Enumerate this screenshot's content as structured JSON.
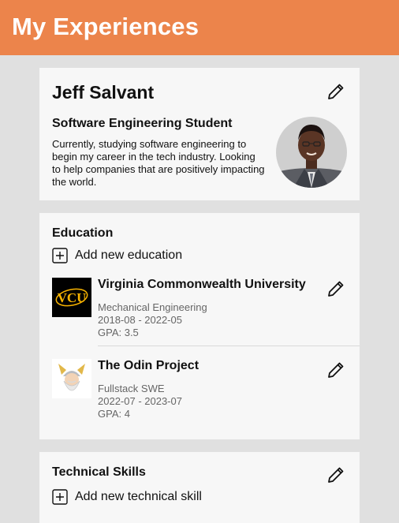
{
  "header": {
    "title": "My Experiences"
  },
  "profile": {
    "name": "Jeff Salvant",
    "headline": "Software Engineering Student",
    "bio": "Currently, studying software engineering to begin my career in the tech industry. Looking to help companies that are positively impacting the world.",
    "edit_icon": "pencil-icon"
  },
  "education": {
    "title": "Education",
    "add_label": "Add new education",
    "items": [
      {
        "school": "Virginia Commonwealth University",
        "logo_text": "VCU",
        "field": "Mechanical Engineering",
        "dates": "2018-08 - 2022-05",
        "gpa": "GPA: 3.5"
      },
      {
        "school": "The Odin Project",
        "field": "Fullstack SWE",
        "dates": "2022-07 - 2023-07",
        "gpa": "GPA: 4"
      }
    ]
  },
  "skills": {
    "title": "Technical Skills",
    "add_label": "Add new technical skill"
  },
  "colors": {
    "header_bg": "#ec844b",
    "page_bg": "#e0e0e0",
    "card_bg": "#f7f7f7",
    "vcu_gold": "#f8b300"
  }
}
